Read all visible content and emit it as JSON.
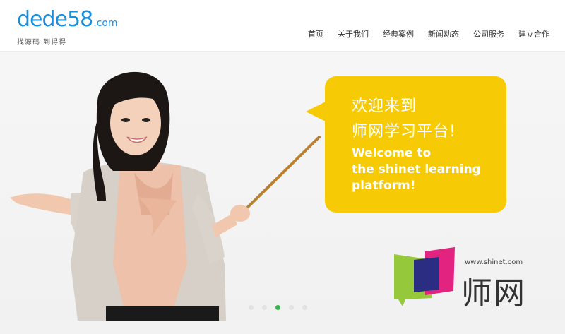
{
  "logo": {
    "text_main": "dede",
    "text_num": "58",
    "text_domain": ".com",
    "tagline": "找源码 到得得"
  },
  "nav": {
    "items": [
      {
        "label": "首页"
      },
      {
        "label": "关于我们"
      },
      {
        "label": "经典案例"
      },
      {
        "label": "新闻动态"
      },
      {
        "label": "公司服务"
      },
      {
        "label": "建立合作"
      }
    ]
  },
  "banner": {
    "bubble": {
      "zh_line1": "欢迎来到",
      "zh_line2": "师网学习平台!",
      "en_line1": "Welcome to",
      "en_line2": "the shinet learning",
      "en_line3": "platform!"
    },
    "brand": {
      "url": "www.shinet.com",
      "name": "师网"
    },
    "slides": {
      "count": 5,
      "active_index": 2
    }
  },
  "colors": {
    "accent": "#1d8fd8",
    "bubble": "#f6cb05",
    "dot_active": "#3fb34f"
  }
}
